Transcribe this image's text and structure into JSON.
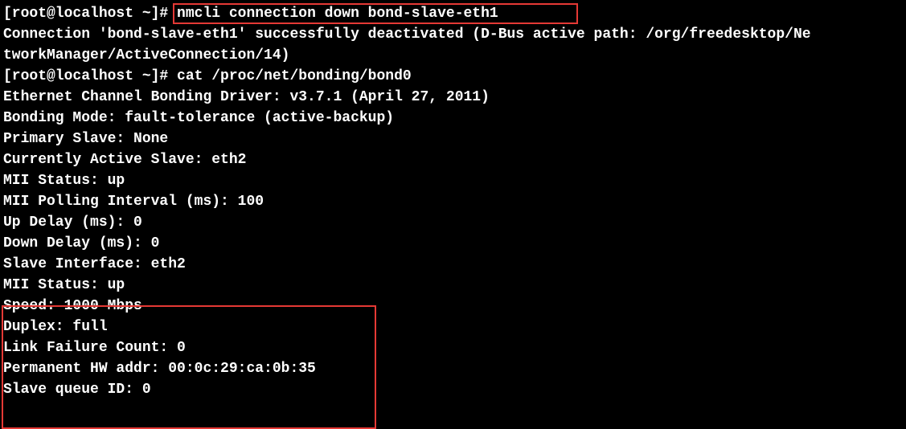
{
  "lines": {
    "l01_prompt1": "[root@localhost ~]# ",
    "l01_cmd1": "nmcli connection down bond-slave-eth1",
    "l02": "Connection 'bond-slave-eth1' successfully deactivated (D-Bus active path: /org/freedesktop/Ne",
    "l03": "tworkManager/ActiveConnection/14)",
    "l04_prompt2": "[root@localhost ~]# ",
    "l04_cmd2": "cat /proc/net/bonding/bond0",
    "l05": "Ethernet Channel Bonding Driver: v3.7.1 (April 27, 2011)",
    "l06": "",
    "l07": "Bonding Mode: fault-tolerance (active-backup)",
    "l08": "Primary Slave: None",
    "l09": "Currently Active Slave: eth2",
    "l10": "MII Status: up",
    "l11": "MII Polling Interval (ms): 100",
    "l12": "Up Delay (ms): 0",
    "l13": "Down Delay (ms): 0",
    "l14": "",
    "l15": "Slave Interface: eth2",
    "l16": "MII Status: up",
    "l17": "Speed: 1000 Mbps",
    "l18": "Duplex: full",
    "l19": "Link Failure Count: 0",
    "l20": "Permanent HW addr: 00:0c:29:ca:0b:35",
    "l21": "Slave queue ID: 0"
  }
}
